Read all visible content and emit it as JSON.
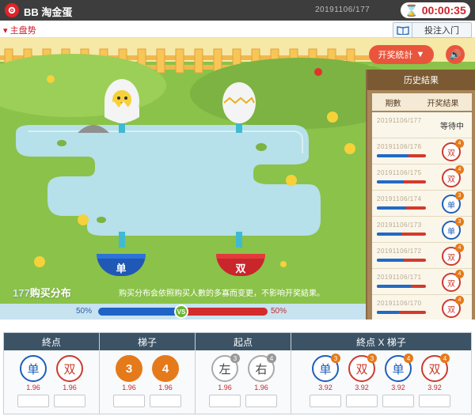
{
  "header": {
    "title": "BB 淘金蛋",
    "round": "20191106/177",
    "timer": "00:00:35"
  },
  "subbar": {
    "trend": "主盘势",
    "guide": "投注入门"
  },
  "scene": {
    "stats_button": "开奖統計",
    "history": {
      "title": "历史結果",
      "col_issue": "期數",
      "col_result": "开奖結果",
      "rows": [
        {
          "issue": "20191106/177",
          "status": "等待中"
        },
        {
          "issue": "20191106/176",
          "result": "双",
          "num": "4",
          "blue": 0.65
        },
        {
          "issue": "20191106/175",
          "result": "双",
          "num": "4",
          "blue": 0.55
        },
        {
          "issue": "20191106/174",
          "result": "单",
          "num": "3",
          "blue": 0.6
        },
        {
          "issue": "20191106/173",
          "result": "单",
          "num": "3",
          "blue": 0.5
        },
        {
          "issue": "20191106/172",
          "result": "双",
          "num": "4",
          "blue": 0.55
        },
        {
          "issue": "20191106/171",
          "result": "双",
          "num": "4",
          "blue": 0.7
        },
        {
          "issue": "20191106/170",
          "result": "双",
          "num": "4",
          "blue": 0.45
        }
      ]
    },
    "bowl_left": "单",
    "bowl_right": "双",
    "dist_count": "177",
    "dist_label": "购买分布",
    "dist_note": "购买分布会依照购买人數的多寡而变更，不影响开奖結果。",
    "pct_left": "50%",
    "pct_right": "50%",
    "vs": "VS"
  },
  "bets": {
    "sections": [
      {
        "title": "終点"
      },
      {
        "title": "梯子"
      },
      {
        "title": "起点"
      },
      {
        "title": "終点 X 梯子"
      }
    ],
    "options": [
      {
        "label": "单",
        "odds": "1.96"
      },
      {
        "label": "双",
        "odds": "1.96"
      },
      {
        "label": "3",
        "odds": "1.96"
      },
      {
        "label": "4",
        "odds": "1.96"
      },
      {
        "label": "左",
        "odds": "1.96",
        "badge": "3"
      },
      {
        "label": "右",
        "odds": "1.96",
        "badge": "4"
      },
      {
        "label": "单",
        "odds": "3.92",
        "badge": "3"
      },
      {
        "label": "双",
        "odds": "3.92",
        "badge": "3"
      },
      {
        "label": "单",
        "odds": "3.92",
        "badge": "4"
      },
      {
        "label": "双",
        "odds": "3.92",
        "badge": "4"
      }
    ]
  },
  "colors": {
    "accent": "#e9553c",
    "odd_blue": "#1e5fb9",
    "even_red": "#cd3a2e"
  }
}
